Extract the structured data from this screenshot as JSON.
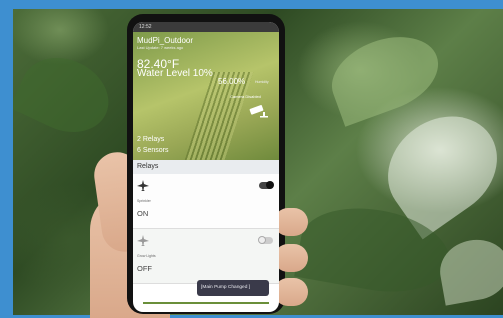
{
  "status_bar": {
    "time": "12:52"
  },
  "hero": {
    "title": "MudPi_Outdoor",
    "subtitle": "Last Update: 7 weeks ago",
    "temperature": "82.40°F",
    "water_level": "Water Level 10%",
    "humidity": "56.00%",
    "humidity_label": "Humidity",
    "camera_status": "Camera Disabled",
    "camera_icon": "security-camera-icon",
    "relays": "2 Relays",
    "sensors": "6 Sensors"
  },
  "relays_section": {
    "heading": "Relays",
    "items": [
      {
        "icon": "plane-icon",
        "label": "Sprinkler",
        "state": "ON",
        "toggle": true
      },
      {
        "icon": "plane-icon",
        "label": "Grow Lights",
        "state": "OFF",
        "toggle": false
      }
    ]
  },
  "toast": {
    "text": "[Main Pump Changed ]"
  },
  "colors": {
    "accent_border": "#3e8fd0",
    "hero_green": "#9aa856",
    "toast_bg": "#3a3a4a"
  }
}
